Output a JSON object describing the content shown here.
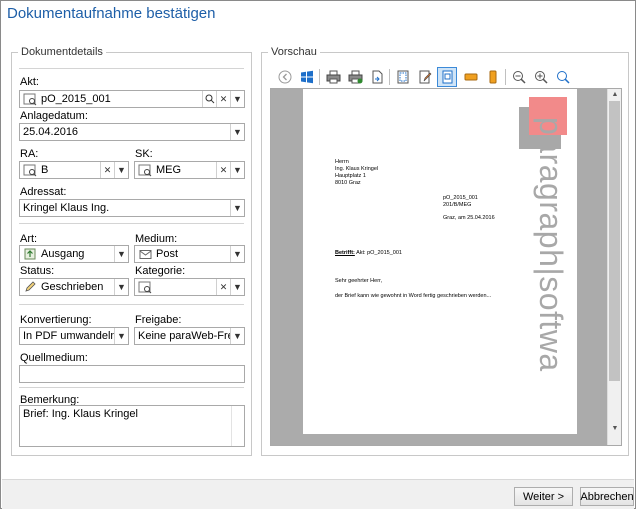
{
  "window": {
    "title": "Dokumentaufnahme bestätigen"
  },
  "details": {
    "legend": "Dokumentdetails",
    "akt": {
      "label": "Akt:",
      "value": "pO_2015_001"
    },
    "anlagedatum": {
      "label": "Anlagedatum:",
      "value": "25.04.2016"
    },
    "ra": {
      "label": "RA:",
      "value": "B"
    },
    "sk": {
      "label": "SK:",
      "value": "MEG"
    },
    "adressat": {
      "label": "Adressat:",
      "value": "Kringel Klaus Ing."
    },
    "art": {
      "label": "Art:",
      "value": "Ausgang"
    },
    "medium": {
      "label": "Medium:",
      "value": "Post"
    },
    "status": {
      "label": "Status:",
      "value": "Geschrieben"
    },
    "kategorie": {
      "label": "Kategorie:",
      "value": ""
    },
    "konvertierung": {
      "label": "Konvertierung:",
      "value": "In PDF umwandeln"
    },
    "freigabe": {
      "label": "Freigabe:",
      "value": "Keine paraWeb-Freig..."
    },
    "quellmedium": {
      "label": "Quellmedium:",
      "value": ""
    },
    "bemerkung": {
      "label": "Bemerkung:",
      "value": "Brief: Ing. Klaus Kringel"
    }
  },
  "preview": {
    "legend": "Vorschau",
    "toolbar_icons": [
      "back-icon",
      "windows-icon",
      "print-icon",
      "print-options-icon",
      "export-icon",
      "page-setup-icon",
      "edit-icon",
      "single-page-icon",
      "fit-width-icon",
      "fit-height-icon",
      "zoom-out-icon",
      "zoom-fit-icon",
      "zoom-in-icon"
    ],
    "letter": {
      "recipient": [
        "Herrn",
        "Ing. Klaus Kringel",
        "Hauptplatz 1",
        "8010 Graz"
      ],
      "reference": [
        "pO_2015_001",
        "201/B/MEG"
      ],
      "date_line": "Graz, am 25.04.2016",
      "subject_label": "Betrifft:",
      "subject_text": "Akt: pO_2015_001",
      "salutation": "Sehr geehrter Herr,",
      "body": "der Brief kann wie gewohnt in Word fertig geschrieben werden...",
      "logo_text": "paragraph|softwa",
      "logo_square_color": "#f28a8a",
      "logo_shadow_color": "#a8a8a8"
    }
  },
  "footer": {
    "next_label": "Weiter >",
    "cancel_label": "Abbrechen"
  },
  "colors": {
    "title": "#1e5fa8",
    "active_tool": "#3c8ad8"
  }
}
